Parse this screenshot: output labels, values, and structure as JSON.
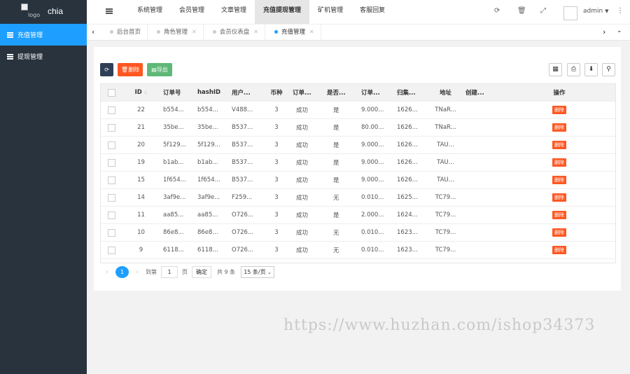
{
  "app": {
    "logo_alt": "logo",
    "logo_text": "chia"
  },
  "sidebar": {
    "items": [
      {
        "label": "充值管理",
        "active": true
      },
      {
        "label": "提现管理",
        "active": false
      }
    ]
  },
  "topnav": {
    "items": [
      "系统管理",
      "会员管理",
      "文章管理",
      "充值提现管理",
      "矿机管理",
      "客服回复"
    ],
    "active_index": 3
  },
  "user": {
    "name": "admin"
  },
  "tabs": [
    {
      "label": "后台首页",
      "closable": false,
      "active": false
    },
    {
      "label": "角色管理",
      "closable": true,
      "active": false
    },
    {
      "label": "会员仪表盘",
      "closable": true,
      "active": false
    },
    {
      "label": "充值管理",
      "closable": true,
      "active": true
    }
  ],
  "toolbar": {
    "refresh_icon": "refresh-icon",
    "delete_label": "删除",
    "export_label": "导出"
  },
  "table": {
    "columns": [
      "ID",
      "订单号",
      "hashID",
      "用户...",
      "币种",
      "订单...",
      "是否...",
      "订单...",
      "归集...",
      "地址",
      "创建...",
      "操作"
    ],
    "rows": [
      [
        "22",
        "b554...",
        "b554...",
        "V488...",
        "3",
        "成功",
        "是",
        "9.000...",
        "1626...",
        "TNaR...",
        "",
        "删除"
      ],
      [
        "21",
        "35be...",
        "35be...",
        "B537...",
        "3",
        "成功",
        "是",
        "80.00...",
        "1626...",
        "TNaR...",
        "",
        "删除"
      ],
      [
        "20",
        "5f129...",
        "5f129...",
        "B537...",
        "3",
        "成功",
        "是",
        "9.000...",
        "1626...",
        "TAU...",
        "",
        "删除"
      ],
      [
        "19",
        "b1ab...",
        "b1ab...",
        "B537...",
        "3",
        "成功",
        "是",
        "9.000...",
        "1626...",
        "TAU...",
        "",
        "删除"
      ],
      [
        "15",
        "1f654...",
        "1f654...",
        "B537...",
        "3",
        "成功",
        "是",
        "9.000...",
        "1626...",
        "TAU...",
        "",
        "删除"
      ],
      [
        "14",
        "3af9e...",
        "3af9e...",
        "F259...",
        "3",
        "成功",
        "无",
        "0.010...",
        "1625...",
        "TC79...",
        "",
        "删除"
      ],
      [
        "11",
        "aa85...",
        "aa85...",
        "O726...",
        "3",
        "成功",
        "是",
        "2.000...",
        "1624...",
        "TC79...",
        "",
        "删除"
      ],
      [
        "10",
        "86e8...",
        "86e8...",
        "O726...",
        "3",
        "成功",
        "无",
        "0.010...",
        "1623...",
        "TC79...",
        "",
        "删除"
      ],
      [
        "9",
        "6118...",
        "6118...",
        "O726...",
        "3",
        "成功",
        "无",
        "0.010...",
        "1623...",
        "TC79...",
        "",
        "删除"
      ]
    ]
  },
  "pager": {
    "current": "1",
    "goto_label": "到第",
    "page_input": "1",
    "page_unit": "页",
    "confirm_label": "确定",
    "total_label": "共 9 条",
    "page_size": "15 条/页"
  },
  "watermark": "https://www.huzhan.com/ishop34373",
  "colors": {
    "primary": "#1e9fff",
    "danger": "#ff5722",
    "success": "#5fb878",
    "sidebar": "#28333e"
  }
}
